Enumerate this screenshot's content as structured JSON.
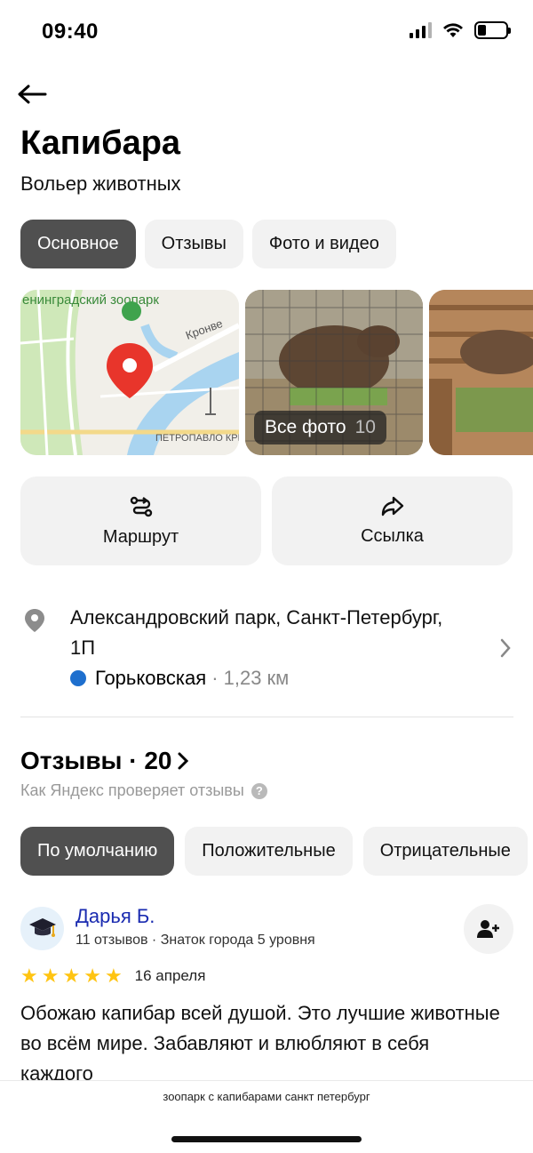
{
  "status_bar": {
    "time": "09:40",
    "battery_level": 0.3
  },
  "header": {
    "title": "Капибара",
    "subtitle": "Вольер животных"
  },
  "tabs": [
    {
      "label": "Основное",
      "active": true
    },
    {
      "label": "Отзывы",
      "active": false
    },
    {
      "label": "Фото и видео",
      "active": false
    }
  ],
  "gallery": {
    "map": {
      "zoo_label": "Ленинградский зоопарк",
      "zoo_label_visible": "енинградский зоопарк",
      "street_label": "Кронве",
      "fortress_label": "ПЕТРОПАВЛО КРЕПС"
    },
    "all_photos_label": "Все фото",
    "all_photos_count": "10"
  },
  "actions": {
    "route_label": "Маршрут",
    "share_label": "Ссылка"
  },
  "address": {
    "text": "Александровский парк, Санкт-Петербург, 1П",
    "metro_name": "Горьковская",
    "metro_distance": "· 1,23 км",
    "metro_color": "#1e6fce"
  },
  "reviews": {
    "title": "Отзывы · 20",
    "note": "Как Яндекс проверяет отзывы",
    "filters": [
      {
        "label": "По умолчанию",
        "active": true
      },
      {
        "label": "Положительные",
        "active": false
      },
      {
        "label": "Отрицательные",
        "active": false
      }
    ],
    "items": [
      {
        "author": "Дарья Б.",
        "meta": "11 отзывов · Знаток города 5 уровня",
        "rating": 5,
        "date": "16 апреля",
        "text": "Обожаю капибар всей душой. Это лучшие животные во всём мире. Забавляют и влюбляют в себя каждого"
      }
    ]
  },
  "bottom": {
    "caption": "зоопарк с капибарами санкт петербург"
  },
  "colors": {
    "accent_dark": "#505050",
    "chip_bg": "#f2f2f2",
    "star": "#ffc412",
    "pin_red": "#e8352b",
    "link": "#1a2bb0"
  }
}
